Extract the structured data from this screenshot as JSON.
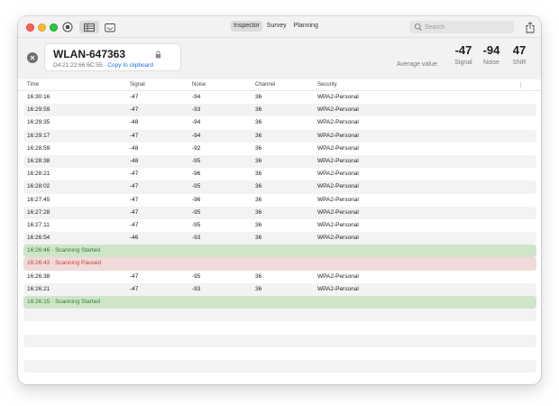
{
  "toolbar": {
    "tabs": [
      {
        "label": "Inspector",
        "active": true
      },
      {
        "label": "Survey",
        "active": false
      },
      {
        "label": "Planning",
        "active": false
      }
    ],
    "search_placeholder": "Search"
  },
  "network": {
    "name": "WLAN-647363",
    "mac": "D4:21:22:66:6C:55",
    "separator": " · ",
    "copy_label": "Copy to clipboard"
  },
  "averages": {
    "label": "Average value:",
    "signal": {
      "value": "-47",
      "label": "Signal"
    },
    "noise": {
      "value": "-94",
      "label": "Noise"
    },
    "snr": {
      "value": "47",
      "label": "SNR"
    }
  },
  "table": {
    "columns": [
      "Time",
      "Signal",
      "Noise",
      "Channel",
      "Security"
    ],
    "rows": [
      {
        "kind": "data",
        "time": "16:30:16",
        "signal": "-47",
        "noise": "-94",
        "channel": "36",
        "security": "WPA2-Personal"
      },
      {
        "kind": "data",
        "time": "16:29:59",
        "signal": "-47",
        "noise": "-93",
        "channel": "36",
        "security": "WPA2-Personal"
      },
      {
        "kind": "data",
        "time": "16:29:35",
        "signal": "-48",
        "noise": "-94",
        "channel": "36",
        "security": "WPA2-Personal"
      },
      {
        "kind": "data",
        "time": "16:29:17",
        "signal": "-47",
        "noise": "-94",
        "channel": "36",
        "security": "WPA2-Personal"
      },
      {
        "kind": "data",
        "time": "16:28:59",
        "signal": "-48",
        "noise": "-92",
        "channel": "36",
        "security": "WPA2-Personal"
      },
      {
        "kind": "data",
        "time": "16:28:38",
        "signal": "-48",
        "noise": "-95",
        "channel": "36",
        "security": "WPA2-Personal"
      },
      {
        "kind": "data",
        "time": "16:28:21",
        "signal": "-47",
        "noise": "-96",
        "channel": "36",
        "security": "WPA2-Personal"
      },
      {
        "kind": "data",
        "time": "16:28:02",
        "signal": "-47",
        "noise": "-95",
        "channel": "36",
        "security": "WPA2-Personal"
      },
      {
        "kind": "data",
        "time": "16:27:45",
        "signal": "-47",
        "noise": "-96",
        "channel": "36",
        "security": "WPA2-Personal"
      },
      {
        "kind": "data",
        "time": "16:27:28",
        "signal": "-47",
        "noise": "-95",
        "channel": "36",
        "security": "WPA2-Personal"
      },
      {
        "kind": "data",
        "time": "16:27:11",
        "signal": "-47",
        "noise": "-95",
        "channel": "36",
        "security": "WPA2-Personal"
      },
      {
        "kind": "data",
        "time": "16:26:54",
        "signal": "-46",
        "noise": "-93",
        "channel": "36",
        "security": "WPA2-Personal"
      },
      {
        "kind": "event-start",
        "text": "16:26:46 · Scanning Started"
      },
      {
        "kind": "event-pause",
        "text": "16:26:43 · Scanning Paused"
      },
      {
        "kind": "data",
        "time": "16:26:38",
        "signal": "-47",
        "noise": "-95",
        "channel": "36",
        "security": "WPA2-Personal"
      },
      {
        "kind": "data",
        "time": "16:26:21",
        "signal": "-47",
        "noise": "-93",
        "channel": "36",
        "security": "WPA2-Personal"
      },
      {
        "kind": "event-start",
        "text": "16:26:15 · Scanning Started"
      },
      {
        "kind": "empty"
      },
      {
        "kind": "empty"
      },
      {
        "kind": "empty"
      },
      {
        "kind": "empty"
      },
      {
        "kind": "empty"
      },
      {
        "kind": "empty"
      }
    ]
  },
  "colors": {
    "accent_link": "#1a6fe0",
    "started_bg": "#cfe5c9",
    "started_text": "#2f7d2f",
    "paused_bg": "#f1dada",
    "paused_text": "#c94040"
  },
  "icons": {
    "window_controls": [
      "close-dot",
      "minimize-dot",
      "zoom-dot"
    ],
    "toolbar": [
      "stop-icon",
      "list-view-icon",
      "pdf-export-icon",
      "share-icon"
    ],
    "header": [
      "close-circle-icon",
      "lock-icon"
    ]
  }
}
